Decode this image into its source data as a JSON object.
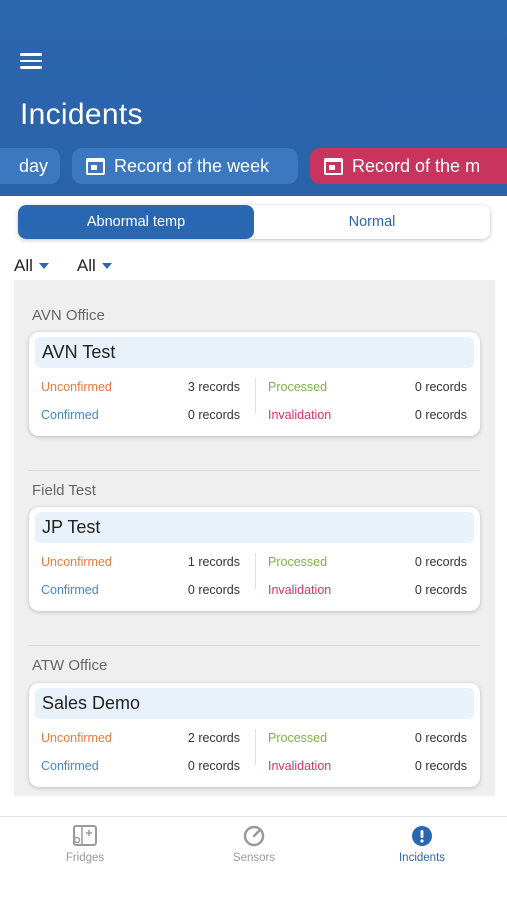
{
  "header": {
    "title": "Incidents",
    "menu_icon": "hamburger-menu-icon",
    "chips": [
      {
        "label": "day"
      },
      {
        "label": "Record of the week",
        "icon": "calendar-icon"
      },
      {
        "label": "Record of the m",
        "icon": "calendar-icon",
        "color": "#c8345e"
      }
    ]
  },
  "segment": {
    "options": [
      "Abnormal temp",
      "Normal"
    ],
    "selected": "Abnormal temp"
  },
  "filters": [
    "All",
    "All"
  ],
  "groups": [
    {
      "name": "AVN Office",
      "card": {
        "title": "AVN Test",
        "unconfirmed_label": "Unconfirmed",
        "unconfirmed_value": "3 records",
        "processed_label": "Processed",
        "processed_value": "0 records",
        "confirmed_label": "Confirmed",
        "confirmed_value": "0 records",
        "invalidation_label": "Invalidation",
        "invalidation_value": "0 records"
      }
    },
    {
      "name": "Field Test",
      "card": {
        "title": "JP Test",
        "unconfirmed_label": "Unconfirmed",
        "unconfirmed_value": "1 records",
        "processed_label": "Processed",
        "processed_value": "0 records",
        "confirmed_label": "Confirmed",
        "confirmed_value": "0 records",
        "invalidation_label": "Invalidation",
        "invalidation_value": "0 records"
      }
    },
    {
      "name": "ATW Office",
      "card": {
        "title": "Sales Demo",
        "unconfirmed_label": "Unconfirmed",
        "unconfirmed_value": "2 records",
        "processed_label": "Processed",
        "processed_value": "0 records",
        "confirmed_label": "Confirmed",
        "confirmed_value": "0 records",
        "invalidation_label": "Invalidation",
        "invalidation_value": "0 records"
      }
    }
  ],
  "colors": {
    "header": "#2a63aa",
    "unconfirmed": "#e8793f",
    "processed": "#7cb342",
    "confirmed": "#3f88c5",
    "invalidation": "#d6336c",
    "tab_active": "#2a67b3",
    "tab_inactive": "#9a9a9a"
  },
  "tabbar": {
    "tabs": [
      {
        "label": "Fridges",
        "icon": "fridge-icon",
        "active": false
      },
      {
        "label": "Sensors",
        "icon": "sensor-gauge-icon",
        "active": false
      },
      {
        "label": "Incidents",
        "icon": "alert-circle-icon",
        "active": true
      }
    ]
  }
}
